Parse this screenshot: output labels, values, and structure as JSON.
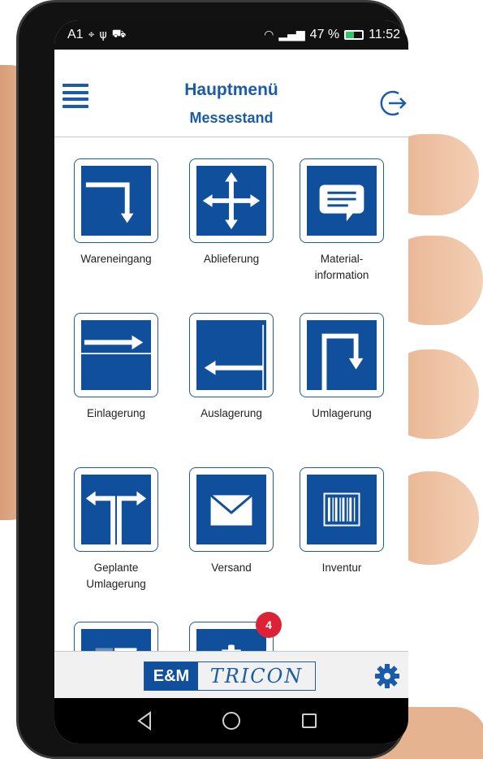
{
  "status_bar": {
    "carrier": "A1",
    "battery": "47 %",
    "battery_level": 0.47,
    "time": "11:52",
    "icons": [
      "location-icon",
      "usb-icon",
      "car-icon",
      "wifi-icon",
      "signal-icon",
      "battery-icon"
    ]
  },
  "header": {
    "title": "Hauptmenü",
    "subtitle": "Messestand",
    "menu_icon": "hamburger-menu-icon",
    "logout_icon": "logout-icon"
  },
  "tiles": [
    {
      "label": "Wareneingang",
      "icon": "arrow-right-down-icon"
    },
    {
      "label": "Ablieferung",
      "icon": "move-arrows-icon"
    },
    {
      "label": "Material-\ninformation",
      "icon": "message-list-icon"
    },
    {
      "label": "Einlagerung",
      "icon": "arrow-right-icon"
    },
    {
      "label": "Auslagerung",
      "icon": "arrow-left-return-icon"
    },
    {
      "label": "Umlagerung",
      "icon": "arrow-up-down-icon"
    },
    {
      "label": "Geplante\nUmlagerung",
      "icon": "split-arrows-icon"
    },
    {
      "label": "Versand",
      "icon": "envelope-icon"
    },
    {
      "label": "Inventur",
      "icon": "barcode-icon"
    },
    {
      "label": "",
      "icon": "panel-icon"
    },
    {
      "label": "",
      "icon": "alarm-clipboard-icon",
      "badge": "4"
    }
  ],
  "footer": {
    "logo_left": "E&M",
    "logo_right": "TRICON",
    "settings_icon": "gear-icon"
  },
  "colors": {
    "brand_blue": "#0f4f9c",
    "header_blue": "#1a5ca8",
    "badge_red": "#dc2336"
  }
}
